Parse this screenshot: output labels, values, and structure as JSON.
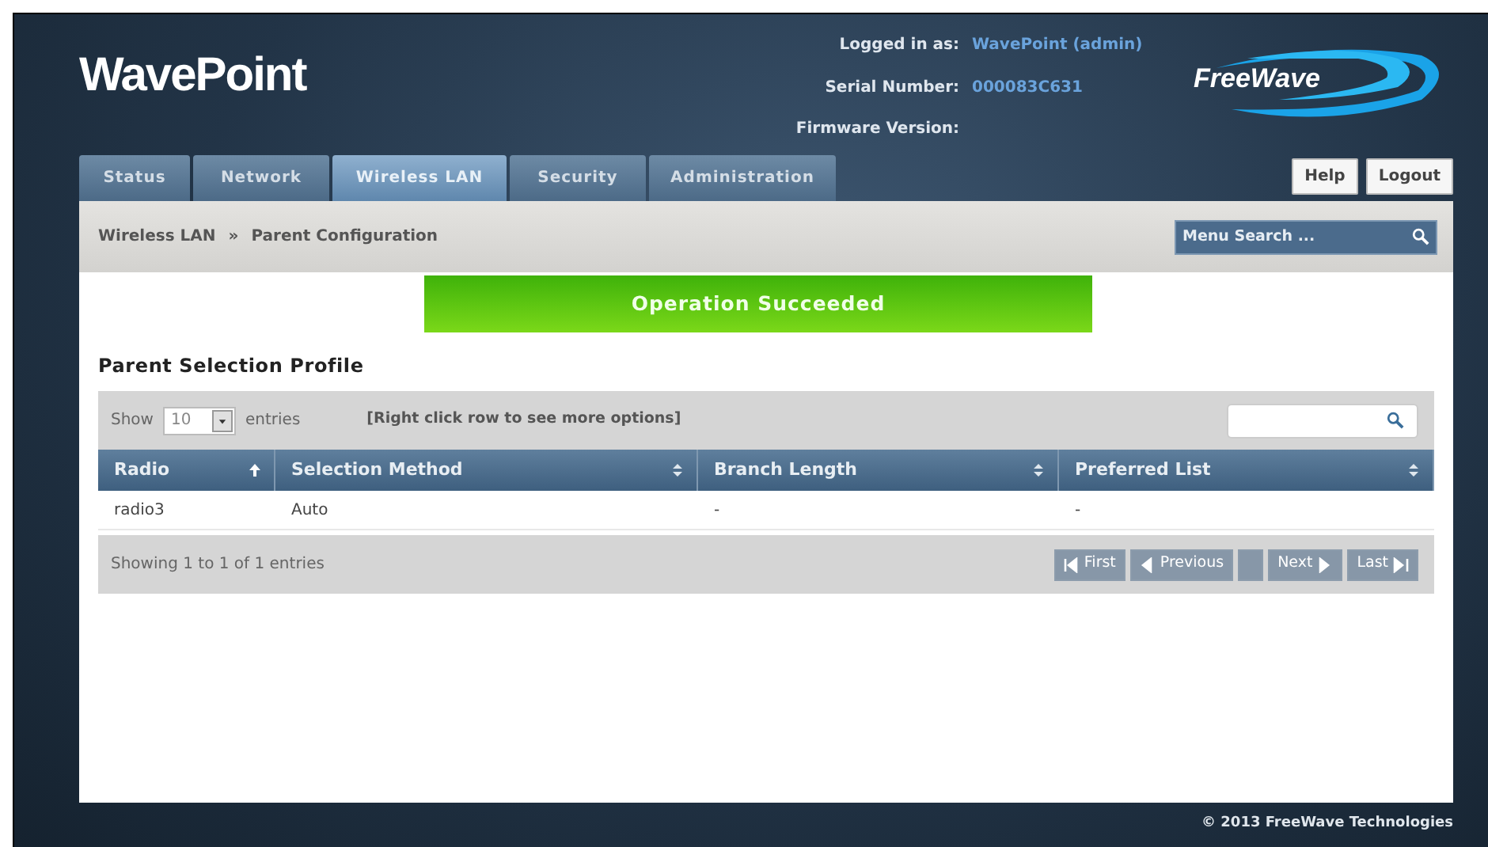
{
  "header": {
    "logo": "WavePoint",
    "info": [
      {
        "label": "Logged in as:",
        "value": "WavePoint (admin)"
      },
      {
        "label": "Serial Number:",
        "value": "000083C631"
      },
      {
        "label": "Firmware Version:"
      }
    ],
    "brand": "FreeWave"
  },
  "tabs": [
    {
      "label": "Status",
      "selected": false
    },
    {
      "label": "Network",
      "selected": false
    },
    {
      "label": "Wireless LAN",
      "selected": true
    },
    {
      "label": "Security",
      "selected": false
    },
    {
      "label": "Administration",
      "selected": false
    }
  ],
  "header_buttons": [
    "Help",
    "Logout"
  ],
  "breadcrumb": [
    "Wireless LAN",
    "»",
    "Parent Configuration"
  ],
  "menu_search": {
    "placeholder": "Menu Search ..."
  },
  "alert": "Operation Succeeded",
  "section_title": "Parent Selection Profile",
  "table": {
    "show_label": "Show",
    "page_size": "10",
    "entries_label": "entries",
    "hint": "[Right click row to see more options]",
    "columns": [
      {
        "label": "Radio",
        "sorted": true
      },
      {
        "label": "Selection Method",
        "sorted": false
      },
      {
        "label": "Branch Length",
        "sorted": false
      },
      {
        "label": "Preferred List",
        "sorted": false
      }
    ],
    "rows": [
      [
        "radio3",
        "Auto",
        "-",
        "-"
      ]
    ],
    "info": "Showing 1 to 1 of 1 entries",
    "pager": [
      {
        "label": "First",
        "kind": "first",
        "disabled": true
      },
      {
        "label": "Previous",
        "kind": "prev",
        "disabled": true
      },
      {
        "kind": "page",
        "disabled": true
      },
      {
        "label": "Next",
        "kind": "next",
        "disabled": true
      },
      {
        "label": "Last",
        "kind": "last",
        "disabled": true
      }
    ]
  },
  "footer": "© 2013 FreeWave Technologies"
}
